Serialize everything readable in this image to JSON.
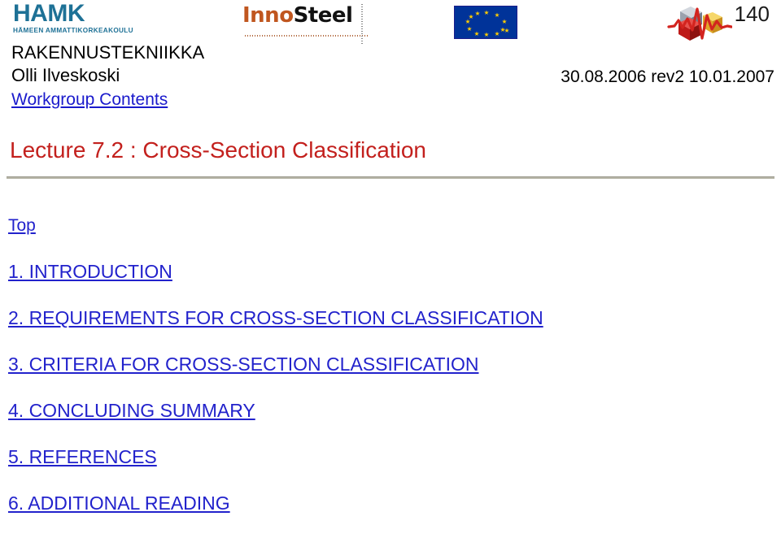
{
  "header": {
    "hamk_logo": {
      "wordmark": "HAMK",
      "subtitle": "HÄMEEN AMMATTIKORKEAKOULU",
      "color": "#1E7196"
    },
    "innosteel_logo": {
      "part_one": "Inno",
      "part_two": "Steel",
      "part_one_color": "#C0561F",
      "part_two_color": "#111111"
    },
    "eu_flag": {
      "name": "European Union flag",
      "background_color": "#003399",
      "star_color": "#FFCC00",
      "star_count": 12
    },
    "cube_logo": {
      "name": "steel-cubes-waveform-logo",
      "colors": [
        "#9DA4B0",
        "#F2C230",
        "#C8201E"
      ]
    },
    "page_number": "140"
  },
  "byline": {
    "department": "RAKENNUSTEKNIIKKA",
    "author": "Olli Ilveskoski",
    "date": "30.08.2006  rev2 10.01.2007",
    "workgroup_link": "Workgroup Contents"
  },
  "title": {
    "text": "Lecture 7.2 : Cross-Section Classification",
    "color": "#C3201D"
  },
  "toc": {
    "top_link": "Top",
    "link_color": "#2222CC",
    "items": [
      {
        "label": "1. INTRODUCTION"
      },
      {
        "label": "2. REQUIREMENTS FOR CROSS-SECTION CLASSIFICATION"
      },
      {
        "label": "3. CRITERIA FOR CROSS-SECTION CLASSIFICATION"
      },
      {
        "label": "4. CONCLUDING SUMMARY"
      },
      {
        "label": "5. REFERENCES"
      },
      {
        "label": "6. ADDITIONAL READING"
      }
    ]
  }
}
